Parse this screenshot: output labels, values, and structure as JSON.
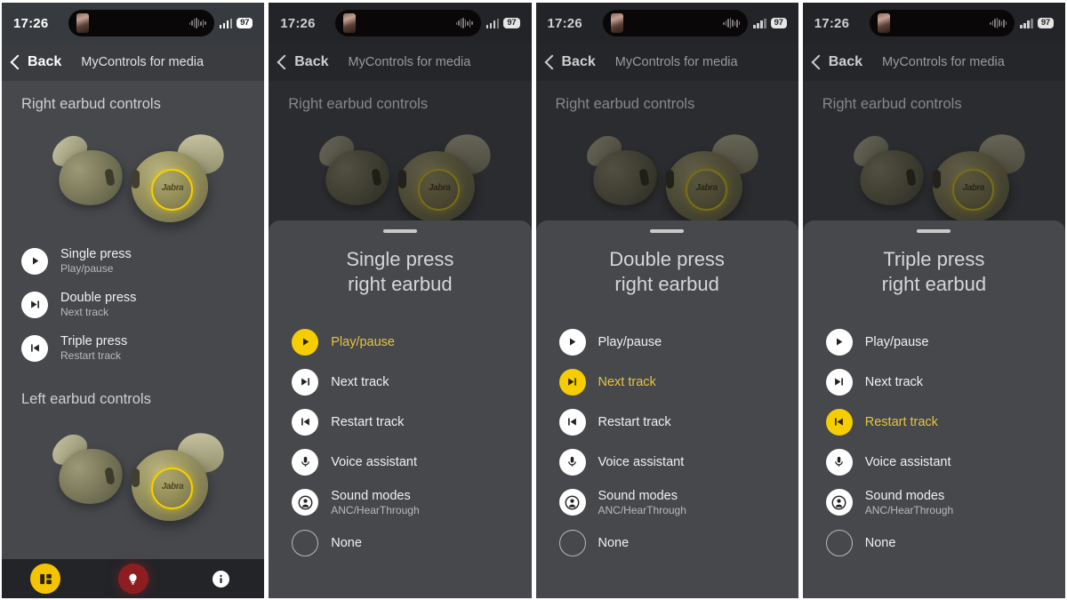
{
  "status": {
    "time": "17:26",
    "battery": "97",
    "signal_icon": "cellular-signal-icon",
    "island_thumb_icon": "media-thumbnail-icon",
    "island_wave_icon": "audio-waveform-icon"
  },
  "nav": {
    "back_label": "Back",
    "back_icon": "chevron-left-icon",
    "title": "MyControls for media"
  },
  "sections": {
    "right_earbud": "Right earbud controls",
    "left_earbud": "Left earbud controls",
    "earbud_logo": "Jabra"
  },
  "assignments": [
    {
      "title": "Single press",
      "subtitle": "Play/pause",
      "icon": "play-pause-icon"
    },
    {
      "title": "Double press",
      "subtitle": "Next track",
      "icon": "next-track-icon"
    },
    {
      "title": "Triple press",
      "subtitle": "Restart track",
      "icon": "restart-track-icon"
    }
  ],
  "tabbar": [
    {
      "name": "tab-controls",
      "icon": "panels-icon",
      "color": "#f5c400"
    },
    {
      "name": "tab-discover",
      "icon": "lightbulb-icon",
      "color": "#8e1d22"
    },
    {
      "name": "tab-info",
      "icon": "info-icon",
      "color": "#ffffff"
    }
  ],
  "options": [
    {
      "label": "Play/pause",
      "sub": "",
      "icon": "play-pause-icon"
    },
    {
      "label": "Next track",
      "sub": "",
      "icon": "next-track-icon"
    },
    {
      "label": "Restart track",
      "sub": "",
      "icon": "restart-track-icon"
    },
    {
      "label": "Voice assistant",
      "sub": "",
      "icon": "microphone-icon"
    },
    {
      "label": "Sound modes",
      "sub": "ANC/HearThrough",
      "icon": "sound-modes-icon"
    },
    {
      "label": "None",
      "sub": "",
      "icon": "empty-circle-icon"
    }
  ],
  "panels": [
    {
      "id": "panel-overview",
      "mode": "overview"
    },
    {
      "id": "panel-single-press",
      "mode": "sheet",
      "sheet_title_line1": "Single press",
      "sheet_title_line2": "right earbud",
      "selected_index": 0
    },
    {
      "id": "panel-double-press",
      "mode": "sheet",
      "sheet_title_line1": "Double press",
      "sheet_title_line2": "right earbud",
      "selected_index": 1
    },
    {
      "id": "panel-triple-press",
      "mode": "sheet",
      "sheet_title_line1": "Triple press",
      "sheet_title_line2": "right earbud",
      "selected_index": 2
    }
  ],
  "colors": {
    "accent_yellow": "#f5cd00",
    "selected_text": "#e7c43c",
    "panel_bg": "#46484c",
    "dim_bg": "#2b2c2f",
    "tabbar_bg": "#232428",
    "red": "#8e1d22"
  }
}
